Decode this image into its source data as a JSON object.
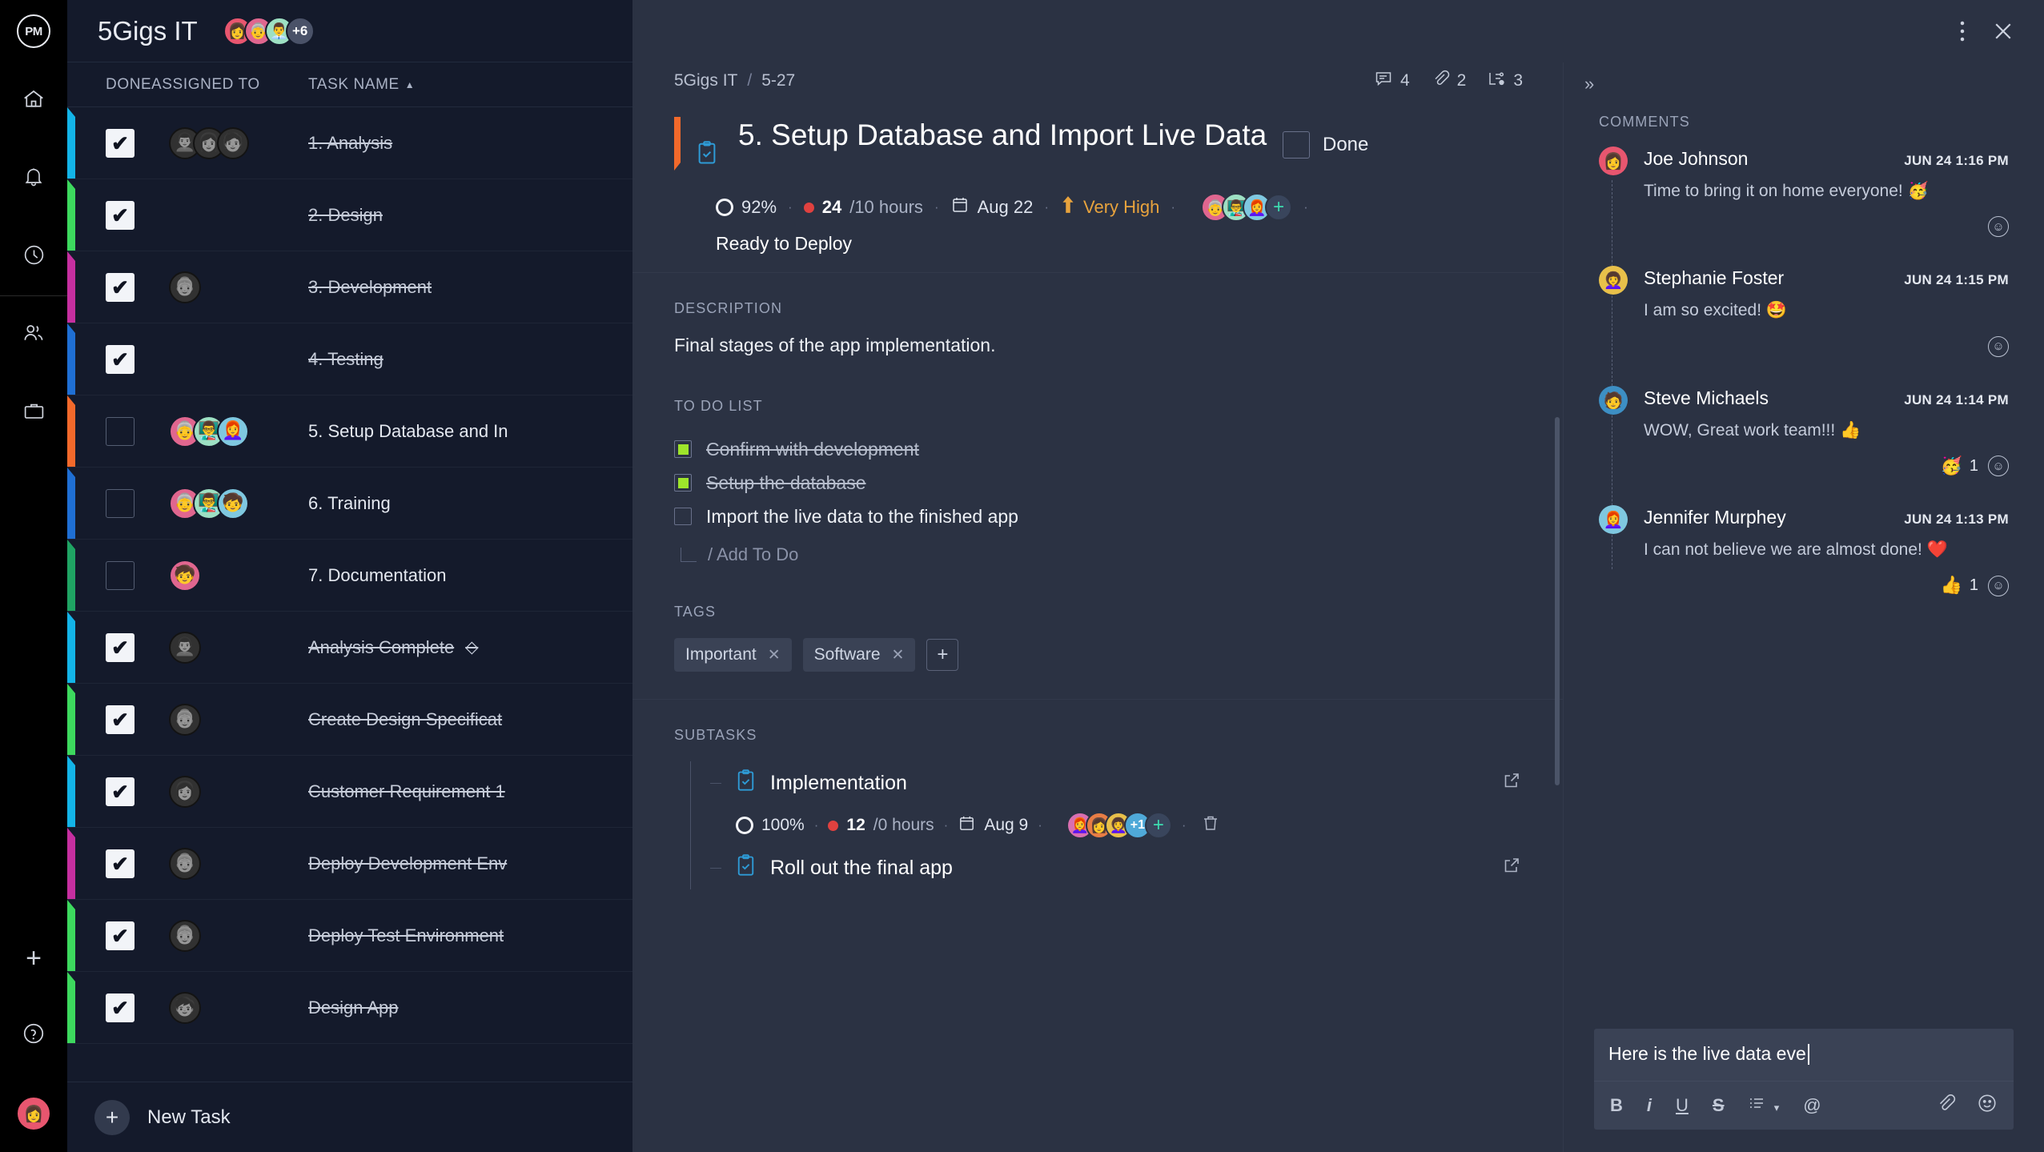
{
  "rail": {
    "logo_text": "PM",
    "items": [
      {
        "name": "home-icon",
        "label": "Home"
      },
      {
        "name": "bell-icon",
        "label": "Notifications"
      },
      {
        "name": "clock-icon",
        "label": "Timesheets"
      },
      {
        "name": "people-icon",
        "label": "Team"
      },
      {
        "name": "briefcase-icon",
        "label": "Portfolio"
      }
    ],
    "add_label": "+",
    "help_label": "?",
    "avatar_emoji": "👩"
  },
  "list": {
    "project_title": "5Gigs IT",
    "avatars": [
      "👩",
      "👵",
      "👨‍💼"
    ],
    "avatar_overflow": "+6",
    "columns": {
      "done": "DONE",
      "assigned": "ASSIGNED TO",
      "task": "TASK NAME",
      "sort": "▲"
    },
    "new_task_label": "New Task",
    "new_task_plus": "+",
    "rows": [
      {
        "flag": "#13b4e8",
        "done": true,
        "name": "1. Analysis",
        "strike": true,
        "avatars": [
          "👨‍🦱",
          "👩",
          "🧑"
        ],
        "gray": true,
        "milestone": false
      },
      {
        "flag": "#3dd95e",
        "done": true,
        "name": "2. Design",
        "strike": true,
        "avatars": [],
        "gray": true,
        "milestone": false
      },
      {
        "flag": "#c62fa0",
        "done": true,
        "name": "3. Development",
        "strike": true,
        "avatars": [
          "👵"
        ],
        "gray": true,
        "milestone": false
      },
      {
        "flag": "#1f6fd4",
        "done": true,
        "name": "4. Testing",
        "strike": true,
        "avatars": [],
        "gray": true,
        "milestone": false
      },
      {
        "flag": "#f2692b",
        "done": false,
        "name": "5. Setup Database and In",
        "strike": false,
        "avatars": [
          "👵",
          "👨‍🏫",
          "👩‍🦰"
        ],
        "gray": false,
        "milestone": false
      },
      {
        "flag": "#1f6fd4",
        "done": false,
        "name": "6. Training",
        "strike": false,
        "avatars": [
          "👵",
          "👨‍🏫",
          "🧒"
        ],
        "gray": false,
        "milestone": false
      },
      {
        "flag": "#1fa463",
        "done": false,
        "name": "7. Documentation",
        "strike": false,
        "avatars": [
          "🧒"
        ],
        "gray": false,
        "milestone": false
      },
      {
        "flag": "#13b4e8",
        "done": true,
        "name": "Analysis Complete",
        "strike": true,
        "avatars": [
          "👨‍🦱"
        ],
        "gray": true,
        "milestone": true
      },
      {
        "flag": "#3dd95e",
        "done": true,
        "name": "Create Design Specificat",
        "strike": true,
        "avatars": [
          "👵"
        ],
        "gray": true,
        "milestone": false
      },
      {
        "flag": "#13b4e8",
        "done": true,
        "name": "Customer Requirement 1",
        "strike": true,
        "avatars": [
          "👩"
        ],
        "gray": true,
        "milestone": false
      },
      {
        "flag": "#c62fa0",
        "done": true,
        "name": "Deploy Development Env",
        "strike": true,
        "avatars": [
          "👵"
        ],
        "gray": true,
        "milestone": false
      },
      {
        "flag": "#3dd95e",
        "done": true,
        "name": "Deploy Test Environment",
        "strike": true,
        "avatars": [
          "👵"
        ],
        "gray": true,
        "milestone": false
      },
      {
        "flag": "#3dd95e",
        "done": true,
        "name": "Design App",
        "strike": true,
        "avatars": [
          "🧒"
        ],
        "gray": true,
        "milestone": false
      }
    ]
  },
  "detail": {
    "menu_icon": "more-vertical-icon",
    "close_icon": "close-icon",
    "breadcrumb_project": "5Gigs IT",
    "breadcrumb_sep": "/",
    "breadcrumb_id": "5-27",
    "counters": [
      {
        "icon": "comment-icon",
        "value": "4"
      },
      {
        "icon": "attachment-icon",
        "value": "2"
      },
      {
        "icon": "subtask-icon",
        "value": "3"
      }
    ],
    "title": "5. Setup Database and Import Live Data",
    "done_label": "Done",
    "done_checked": false,
    "flag_color": "#f2692b",
    "meta": {
      "progress": "92%",
      "hours_worked": "24",
      "hours_sep": "/10 hours",
      "date": "Aug 22",
      "priority": "Very High",
      "priority_color": "#e8a33d",
      "avatars": [
        "👵",
        "👨‍🏫",
        "👩‍🦰"
      ],
      "add_assignee": "+"
    },
    "status": "Ready to Deploy",
    "description_label": "DESCRIPTION",
    "description": "Final stages of the app implementation.",
    "todo_label": "TO DO LIST",
    "todos": [
      {
        "text": "Confirm with development",
        "checked": true
      },
      {
        "text": "Setup the database",
        "checked": true
      },
      {
        "text": "Import the live data to the finished app",
        "checked": false
      }
    ],
    "add_todo": "/ Add To Do",
    "tags_label": "TAGS",
    "tags": [
      "Important",
      "Software"
    ],
    "tag_remove": "✕",
    "tag_add": "+",
    "subtasks_label": "SUBTASKS",
    "subtasks": [
      {
        "name": "Implementation",
        "progress": "100%",
        "hours_worked": "12",
        "hours_sep": "/0 hours",
        "date": "Aug 9",
        "avatars": [
          "👩‍🦰",
          "👩",
          "👩‍🦱"
        ],
        "avatar_overflow": "+1",
        "add_assignee": "+",
        "has_meta": true
      },
      {
        "name": "Roll out the final app",
        "has_meta": false
      }
    ]
  },
  "comments": {
    "expand_icon": "»",
    "title": "COMMENTS",
    "items": [
      {
        "author": "Joe Johnson",
        "time": "JUN 24 1:16 PM",
        "text": "Time to bring it on home everyone! 🥳",
        "avatar": "👩",
        "avatar_color": "#e8566f",
        "reactions": []
      },
      {
        "author": "Stephanie Foster",
        "time": "JUN 24 1:15 PM",
        "text": "I am so excited! 🤩",
        "avatar": "👩‍🦱",
        "avatar_color": "#f0c game",
        "reactions": []
      },
      {
        "author": "Steve Michaels",
        "time": "JUN 24 1:14 PM",
        "text": "WOW, Great work team!!! 👍",
        "avatar": "🧑",
        "avatar_color": "#3d8fc4",
        "reactions": [
          {
            "emoji": "🥳",
            "count": "1"
          }
        ]
      },
      {
        "author": "Jennifer Murphey",
        "time": "JUN 24 1:13 PM",
        "text": "I can not believe we are almost done! ❤️",
        "avatar": "👩‍🦰",
        "avatar_color": "#7fc8e0",
        "reactions": [
          {
            "emoji": "👍",
            "count": "1"
          }
        ]
      }
    ],
    "composer": {
      "value": "Here is the live data eve",
      "tools": [
        "B",
        "i",
        "U",
        "S",
        "≡",
        "@"
      ],
      "attach_icon": "attachment-icon",
      "emoji_icon": "emoji-icon"
    }
  }
}
